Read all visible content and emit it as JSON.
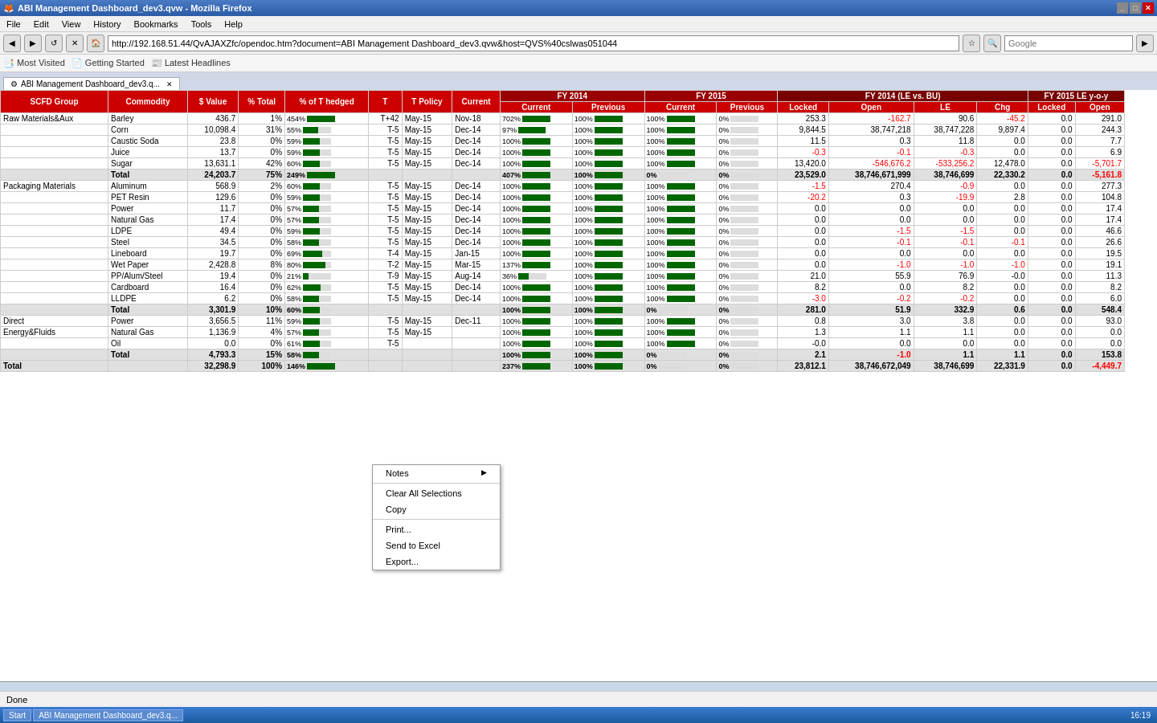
{
  "window": {
    "title": "ABI Management Dashboard_dev3.qvw - Mozilla Firefox"
  },
  "menu": {
    "items": [
      "File",
      "Edit",
      "View",
      "History",
      "Bookmarks",
      "Tools",
      "Help"
    ]
  },
  "nav": {
    "address": "http://192.168.51.44/QvAJAXZfc/opendoc.htm?document=ABI Management Dashboard_dev3.qvw&host=QVS%40cslwas051044",
    "search_placeholder": "Google"
  },
  "bookmarks": {
    "items": [
      "Most Visited",
      "Getting Started",
      "Latest Headlines"
    ]
  },
  "tab": {
    "label": "ABI Management Dashboard_dev3.q..."
  },
  "table": {
    "headers": {
      "col1": "SCFD Group",
      "col2": "Commodity",
      "col3": "$ Value",
      "col4": "% Total",
      "col5": "% of T hedged",
      "col6": "T",
      "col7": "T Policy",
      "col8": "Current",
      "col9": "FY 2014 Current",
      "col10": "FY 2014 Previous",
      "col11": "FY 2015 Current",
      "col12": "FY 2015 Previous",
      "col13": "FY 2014 (LE vs. BU) Locked",
      "col14": "FY 2014 (LE vs. BU) Open",
      "col15": "FY 2014 (LE vs. BU) LE",
      "col16": "FY 2014 (LE vs. BU) Chg",
      "col17": "FY 2015 LE y-o-y Locked",
      "col18": "FY 2015 LE y-o-y Open"
    },
    "rows": [
      {
        "group": "Raw Materials&Aux",
        "commodity": "Barley",
        "value": "436.7",
        "pct_total": "1%",
        "pct_t": "454%",
        "t": "T+42",
        "t_policy": "May-15",
        "current": "Nov-18",
        "fy14cur": "702%",
        "fy14prev": "100%",
        "fy15cur": "100%",
        "fy15prev": "0%",
        "fy14locked": "253.3",
        "fy14open": "-162.7",
        "fy14le": "90.6",
        "fy14chg": "-45.2",
        "fy15locked": "0.0",
        "fy15open": "291.0"
      },
      {
        "group": "",
        "commodity": "Corn",
        "value": "10,098.4",
        "pct_total": "31%",
        "pct_t": "55%",
        "t": "T-5",
        "t_policy": "May-15",
        "current": "Dec-14",
        "fy14cur": "97%",
        "fy14prev": "100%",
        "fy15cur": "100%",
        "fy15prev": "0%",
        "fy14locked": "9,844.5",
        "fy14open": "38,747,218",
        "fy14le": "38,747,228",
        "fy14chg": "9,897.4",
        "fy15locked": "0.0",
        "fy15open": "244.3"
      },
      {
        "group": "",
        "commodity": "Caustic Soda",
        "value": "23.8",
        "pct_total": "0%",
        "pct_t": "59%",
        "t": "T-5",
        "t_policy": "May-15",
        "current": "Dec-14",
        "fy14cur": "100%",
        "fy14prev": "100%",
        "fy15cur": "100%",
        "fy15prev": "0%",
        "fy14locked": "11.5",
        "fy14open": "0.3",
        "fy14le": "11.8",
        "fy14chg": "0.0",
        "fy15locked": "0.0",
        "fy15open": "7.7"
      },
      {
        "group": "",
        "commodity": "Juice",
        "value": "13.7",
        "pct_total": "0%",
        "pct_t": "59%",
        "t": "T-5",
        "t_policy": "May-15",
        "current": "Dec-14",
        "fy14cur": "100%",
        "fy14prev": "100%",
        "fy15cur": "100%",
        "fy15prev": "0%",
        "fy14locked": "-0.3",
        "fy14open": "-0.1",
        "fy14le": "-0.3",
        "fy14chg": "0.0",
        "fy15locked": "0.0",
        "fy15open": "6.9"
      },
      {
        "group": "",
        "commodity": "Sugar",
        "value": "13,631.1",
        "pct_total": "42%",
        "pct_t": "60%",
        "t": "T-5",
        "t_policy": "May-15",
        "current": "Dec-14",
        "fy14cur": "100%",
        "fy14prev": "100%",
        "fy15cur": "100%",
        "fy15prev": "0%",
        "fy14locked": "13,420.0",
        "fy14open": "-546,676.2",
        "fy14le": "-533,256.2",
        "fy14chg": "12,478.0",
        "fy15locked": "0.0",
        "fy15open": "-5,701.7"
      },
      {
        "group": "",
        "commodity": "Total",
        "is_total": true,
        "value": "24,203.7",
        "pct_total": "75%",
        "pct_t": "249%",
        "t": "",
        "t_policy": "",
        "current": "",
        "fy14cur": "407%",
        "fy14prev": "100%",
        "fy15cur": "0%",
        "fy15prev": "0%",
        "fy14locked": "23,529.0",
        "fy14open": "38,746,671,999",
        "fy14le": "38,746,699",
        "fy14chg": "22,330.2",
        "fy15locked": "0.0",
        "fy15open": "-5,161.8"
      },
      {
        "group": "Packaging Materials",
        "commodity": "Aluminum",
        "value": "568.9",
        "pct_total": "2%",
        "pct_t": "60%",
        "t": "T-5",
        "t_policy": "May-15",
        "current": "Dec-14",
        "fy14cur": "100%",
        "fy14prev": "100%",
        "fy15cur": "100%",
        "fy15prev": "0%",
        "fy14locked": "-1.5",
        "fy14open": "270.4",
        "fy14le": "-0.9",
        "fy14chg": "0.0",
        "fy15locked": "0.0",
        "fy15open": "277.3"
      },
      {
        "group": "",
        "commodity": "PET Resin",
        "value": "129.6",
        "pct_total": "0%",
        "pct_t": "59%",
        "t": "T-5",
        "t_policy": "May-15",
        "current": "Dec-14",
        "fy14cur": "100%",
        "fy14prev": "100%",
        "fy15cur": "100%",
        "fy15prev": "0%",
        "fy14locked": "-20.2",
        "fy14open": "0.3",
        "fy14le": "-19.9",
        "fy14chg": "2.8",
        "fy15locked": "0.0",
        "fy15open": "104.8"
      },
      {
        "group": "",
        "commodity": "Power",
        "value": "11.7",
        "pct_total": "0%",
        "pct_t": "57%",
        "t": "T-5",
        "t_policy": "May-15",
        "current": "Dec-14",
        "fy14cur": "100%",
        "fy14prev": "100%",
        "fy15cur": "100%",
        "fy15prev": "0%",
        "fy14locked": "0.0",
        "fy14open": "0.0",
        "fy14le": "0.0",
        "fy14chg": "0.0",
        "fy15locked": "0.0",
        "fy15open": "17.4"
      },
      {
        "group": "",
        "commodity": "Natural Gas",
        "value": "17.4",
        "pct_total": "0%",
        "pct_t": "57%",
        "t": "T-5",
        "t_policy": "May-15",
        "current": "Dec-14",
        "fy14cur": "100%",
        "fy14prev": "100%",
        "fy15cur": "100%",
        "fy15prev": "0%",
        "fy14locked": "0.0",
        "fy14open": "0.0",
        "fy14le": "0.0",
        "fy14chg": "0.0",
        "fy15locked": "0.0",
        "fy15open": "17.4"
      },
      {
        "group": "",
        "commodity": "LDPE",
        "value": "49.4",
        "pct_total": "0%",
        "pct_t": "59%",
        "t": "T-5",
        "t_policy": "May-15",
        "current": "Dec-14",
        "fy14cur": "100%",
        "fy14prev": "100%",
        "fy15cur": "100%",
        "fy15prev": "0%",
        "fy14locked": "0.0",
        "fy14open": "-1.5",
        "fy14le": "-1.5",
        "fy14chg": "0.0",
        "fy15locked": "0.0",
        "fy15open": "46.6"
      },
      {
        "group": "",
        "commodity": "Steel",
        "value": "34.5",
        "pct_total": "0%",
        "pct_t": "58%",
        "t": "T-5",
        "t_policy": "May-15",
        "current": "Dec-14",
        "fy14cur": "100%",
        "fy14prev": "100%",
        "fy15cur": "100%",
        "fy15prev": "0%",
        "fy14locked": "0.0",
        "fy14open": "-0.1",
        "fy14le": "-0.1",
        "fy14chg": "-0.1",
        "fy15locked": "0.0",
        "fy15open": "26.6"
      },
      {
        "group": "",
        "commodity": "Lineboard",
        "value": "19.7",
        "pct_total": "0%",
        "pct_t": "69%",
        "t": "T-4",
        "t_policy": "May-15",
        "current": "Jan-15",
        "fy14cur": "100%",
        "fy14prev": "100%",
        "fy15cur": "100%",
        "fy15prev": "0%",
        "fy14locked": "0.0",
        "fy14open": "0.0",
        "fy14le": "0.0",
        "fy14chg": "0.0",
        "fy15locked": "0.0",
        "fy15open": "19.5"
      },
      {
        "group": "",
        "commodity": "Wet Paper",
        "value": "2,428.8",
        "pct_total": "8%",
        "pct_t": "80%",
        "t": "T-2",
        "t_policy": "May-15",
        "current": "Mar-15",
        "fy14cur": "137%",
        "fy14prev": "100%",
        "fy15cur": "100%",
        "fy15prev": "0%",
        "fy14locked": "0.0",
        "fy14open": "-1.0",
        "fy14le": "-1.0",
        "fy14chg": "-1.0",
        "fy15locked": "0.0",
        "fy15open": "19.1"
      },
      {
        "group": "",
        "commodity": "PP/Alum/Steel",
        "value": "19.4",
        "pct_total": "0%",
        "pct_t": "21%",
        "t": "T-9",
        "t_policy": "May-15",
        "current": "Aug-14",
        "fy14cur": "36%",
        "fy14prev": "100%",
        "fy15cur": "100%",
        "fy15prev": "0%",
        "fy14locked": "21.0",
        "fy14open": "55.9",
        "fy14le": "76.9",
        "fy14chg": "-0.0",
        "fy15locked": "0.0",
        "fy15open": "11.3"
      },
      {
        "group": "",
        "commodity": "Cardboard",
        "value": "16.4",
        "pct_total": "0%",
        "pct_t": "62%",
        "t": "T-5",
        "t_policy": "May-15",
        "current": "Dec-14",
        "fy14cur": "100%",
        "fy14prev": "100%",
        "fy15cur": "100%",
        "fy15prev": "0%",
        "fy14locked": "8.2",
        "fy14open": "0.0",
        "fy14le": "8.2",
        "fy14chg": "0.0",
        "fy15locked": "0.0",
        "fy15open": "8.2"
      },
      {
        "group": "",
        "commodity": "LLDPE",
        "value": "6.2",
        "pct_total": "0%",
        "pct_t": "58%",
        "t": "T-5",
        "t_policy": "May-15",
        "current": "Dec-14",
        "fy14cur": "100%",
        "fy14prev": "100%",
        "fy15cur": "100%",
        "fy15prev": "0%",
        "fy14locked": "-3.0",
        "fy14open": "-0.2",
        "fy14le": "-0.2",
        "fy14chg": "0.0",
        "fy15locked": "0.0",
        "fy15open": "6.0"
      },
      {
        "group": "",
        "commodity": "Total",
        "is_total": true,
        "value": "3,301.9",
        "pct_total": "10%",
        "pct_t": "60%",
        "t": "",
        "t_policy": "",
        "current": "",
        "fy14cur": "100%",
        "fy14prev": "100%",
        "fy15cur": "0%",
        "fy15prev": "0%",
        "fy14locked": "281.0",
        "fy14open": "51.9",
        "fy14le": "332.9",
        "fy14chg": "0.6",
        "fy15locked": "0.0",
        "fy15open": "548.4"
      },
      {
        "group": "Direct",
        "commodity": "Power",
        "value": "3,656.5",
        "pct_total": "11%",
        "pct_t": "59%",
        "t": "T-5",
        "t_policy": "May-15",
        "current": "Dec-11",
        "fy14cur": "100%",
        "fy14prev": "100%",
        "fy15cur": "100%",
        "fy15prev": "0%",
        "fy14locked": "0.8",
        "fy14open": "3.0",
        "fy14le": "3.8",
        "fy14chg": "0.0",
        "fy15locked": "0.0",
        "fy15open": "93.0"
      },
      {
        "group": "Energy&Fluids",
        "commodity": "Natural Gas",
        "value": "1,136.9",
        "pct_total": "4%",
        "pct_t": "57%",
        "t": "T-5",
        "t_policy": "May-15",
        "current": "",
        "fy14cur": "100%",
        "fy14prev": "100%",
        "fy15cur": "100%",
        "fy15prev": "0%",
        "fy14locked": "1.3",
        "fy14open": "1.1",
        "fy14le": "1.1",
        "fy14chg": "0.0",
        "fy15locked": "0.0",
        "fy15open": ""
      },
      {
        "group": "",
        "commodity": "Oil",
        "value": "0.0",
        "pct_total": "0%",
        "pct_t": "61%",
        "t": "T-5",
        "t_policy": "",
        "current": "",
        "fy14cur": "100%",
        "fy14prev": "100%",
        "fy15cur": "100%",
        "fy15prev": "0%",
        "fy14locked": "-0.0",
        "fy14open": "0.0",
        "fy14le": "0.0",
        "fy14chg": "0.0",
        "fy15locked": "0.0",
        "fy15open": "0.0"
      },
      {
        "group": "",
        "commodity": "Total",
        "is_total": true,
        "value": "4,793.3",
        "pct_total": "15%",
        "pct_t": "58%",
        "t": "",
        "t_policy": "",
        "current": "",
        "fy14cur": "100%",
        "fy14prev": "100%",
        "fy15cur": "0%",
        "fy15prev": "0%",
        "fy14locked": "2.1",
        "fy14open": "-1.0",
        "fy14le": "1.1",
        "fy14chg": "1.1",
        "fy15locked": "0.0",
        "fy15open": "153.8"
      },
      {
        "group": "Total",
        "commodity": "",
        "is_grand_total": true,
        "value": "32,298.9",
        "pct_total": "100%",
        "pct_t": "146%",
        "t": "",
        "t_policy": "",
        "current": "",
        "fy14cur": "237%",
        "fy14prev": "100%",
        "fy15cur": "0%",
        "fy15prev": "0%",
        "fy14locked": "23,812.1",
        "fy14open": "38,746,672,049",
        "fy14le": "38,746,699",
        "fy14chg": "22,331.9",
        "fy15locked": "0.0",
        "fy15open": "-4,449.7"
      }
    ]
  },
  "context_menu": {
    "items": [
      {
        "label": "Notes",
        "has_arrow": true
      },
      {
        "label": "Clear All Selections",
        "has_arrow": false
      },
      {
        "label": "Copy",
        "has_arrow": false
      },
      {
        "label": "Print...",
        "has_arrow": false
      },
      {
        "label": "Send to Excel",
        "has_arrow": false
      },
      {
        "label": "Export...",
        "has_arrow": false
      }
    ]
  },
  "status": {
    "text": "Done"
  },
  "taskbar": {
    "start_label": "Start",
    "app_label": "ABI Management Dashboard_dev3.q...",
    "clock": "16:19"
  }
}
